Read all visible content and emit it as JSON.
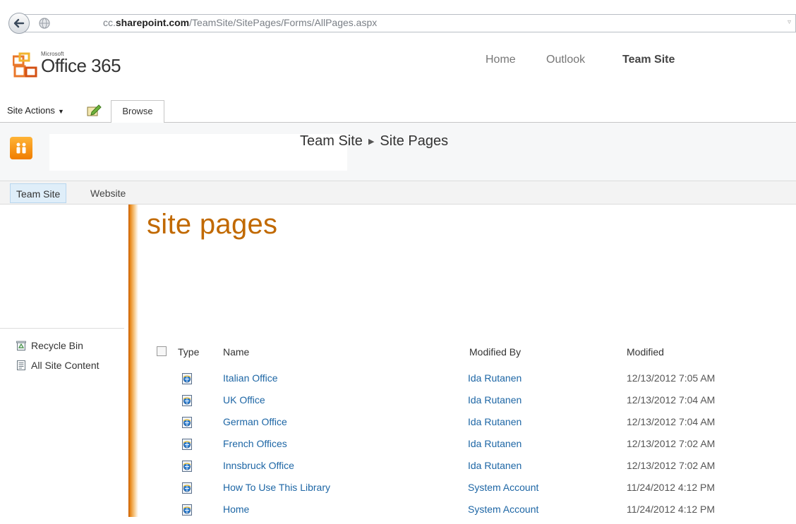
{
  "browser": {
    "url_prefix": "cc.",
    "url_domain": "sharepoint.com",
    "url_path": "/TeamSite/SitePages/Forms/AllPages.aspx"
  },
  "header": {
    "logo_small": "Microsoft",
    "logo_main": "Office 365",
    "nav": [
      {
        "label": "Home",
        "active": false
      },
      {
        "label": "Outlook",
        "active": false
      },
      {
        "label": "Team Site",
        "active": true
      }
    ]
  },
  "ribbon": {
    "site_actions": "Site Actions",
    "browse_tab": "Browse"
  },
  "breadcrumb": {
    "site": "Team Site",
    "page": "Site Pages"
  },
  "linkbar": {
    "items": [
      "Team Site",
      "Website"
    ]
  },
  "leftnav": {
    "recycle_bin": "Recycle Bin",
    "all_site_content": "All Site Content"
  },
  "main": {
    "title": "site pages",
    "columns": {
      "type": "Type",
      "name": "Name",
      "modified_by": "Modified By",
      "modified": "Modified"
    },
    "rows": [
      {
        "name": "Italian Office",
        "modified_by": "Ida Rutanen",
        "modified": "12/13/2012 7:05 AM"
      },
      {
        "name": "UK Office",
        "modified_by": "Ida Rutanen",
        "modified": "12/13/2012 7:04 AM"
      },
      {
        "name": "German Office",
        "modified_by": "Ida Rutanen",
        "modified": "12/13/2012 7:04 AM"
      },
      {
        "name": "French Offices",
        "modified_by": "Ida Rutanen",
        "modified": "12/13/2012 7:02 AM"
      },
      {
        "name": "Innsbruck Office",
        "modified_by": "Ida Rutanen",
        "modified": "12/13/2012 7:02 AM"
      },
      {
        "name": "How To Use This Library",
        "modified_by": "System Account",
        "modified": "11/24/2012 4:12 PM"
      },
      {
        "name": "Home",
        "modified_by": "System Account",
        "modified": "11/24/2012 4:12 PM"
      }
    ]
  },
  "colors": {
    "accent_orange": "#c16900",
    "link_blue": "#1d66a5"
  }
}
